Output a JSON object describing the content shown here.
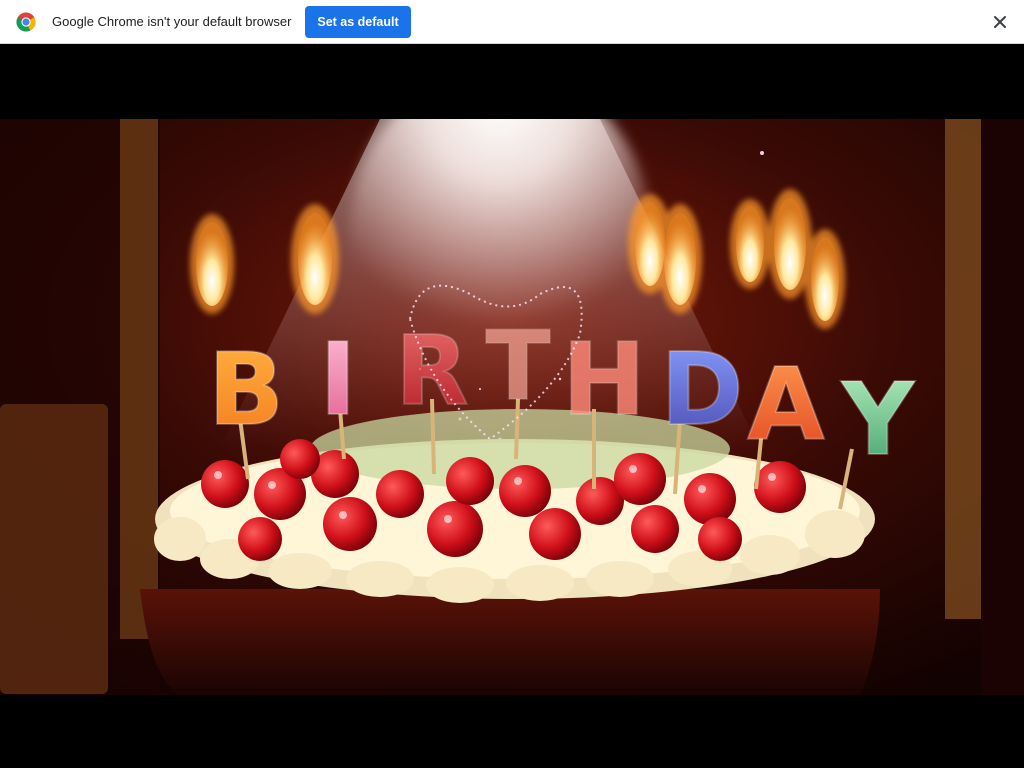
{
  "infobar": {
    "icon": "chrome-logo-icon",
    "message": "Google Chrome isn't your default browser",
    "button_label": "Set as default",
    "button_color": "#1a73e8",
    "close_icon": "close-icon"
  },
  "video": {
    "candle_letters": [
      "B",
      "I",
      "R",
      "T",
      "H",
      "D",
      "A",
      "Y"
    ],
    "colors": {
      "background": "#000000",
      "room": "#2a0604",
      "cherry": "#d0101a",
      "cream": "#f2e8c8"
    }
  }
}
